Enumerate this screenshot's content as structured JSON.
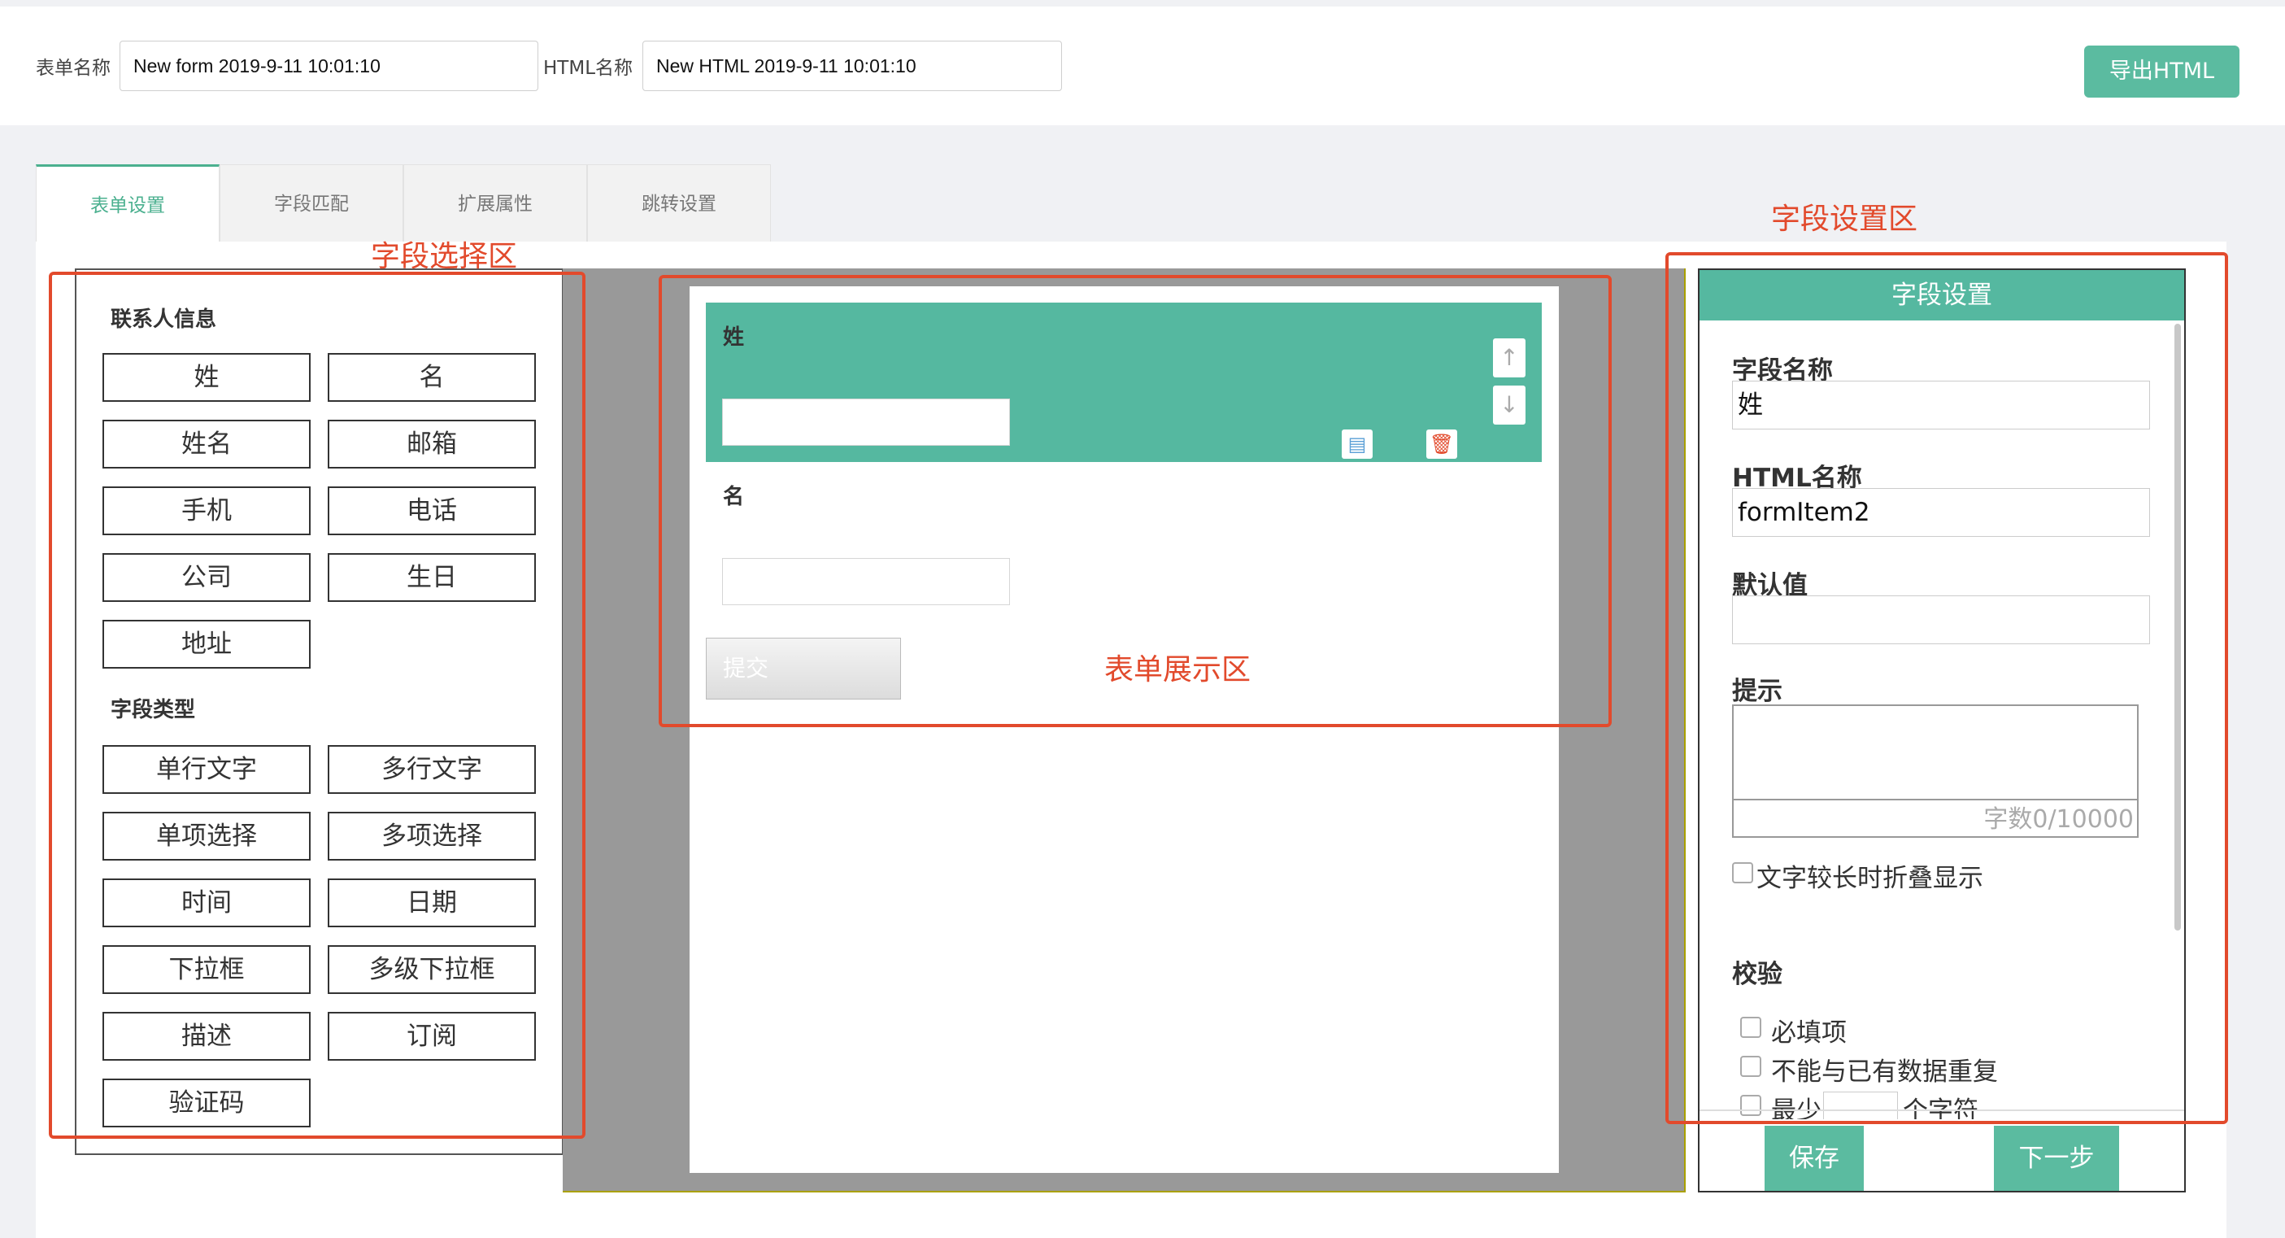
{
  "header": {
    "form_name_label": "表单名称",
    "form_name_value": "New form 2019-9-11 10:01:10",
    "html_name_label": "HTML名称",
    "html_name_value": "New HTML 2019-9-11 10:01:10",
    "export_button": "导出HTML"
  },
  "tabs": [
    {
      "label": "表单设置",
      "active": true
    },
    {
      "label": "字段匹配",
      "active": false
    },
    {
      "label": "扩展属性",
      "active": false
    },
    {
      "label": "跳转设置",
      "active": false
    }
  ],
  "field_selector": {
    "contact_title": "联系人信息",
    "contact_fields": [
      "姓",
      "名",
      "姓名",
      "邮箱",
      "手机",
      "电话",
      "公司",
      "生日",
      "地址"
    ],
    "type_title": "字段类型",
    "type_fields": [
      "单行文字",
      "多行文字",
      "单项选择",
      "多项选择",
      "时间",
      "日期",
      "下拉框",
      "多级下拉框",
      "描述",
      "订阅",
      "验证码"
    ]
  },
  "form_preview": {
    "field1_label": "姓",
    "field2_label": "名",
    "submit_label": "提交",
    "up_arrow": "↑",
    "down_arrow": "↓"
  },
  "settings": {
    "header": "字段设置",
    "field_name_label": "字段名称",
    "field_name_value": "姓",
    "html_name_label": "HTML名称",
    "html_name_value": "formItem2",
    "default_label": "默认值",
    "hint_label": "提示",
    "word_count": "字数0/10000",
    "collapse_label": "文字较长时折叠显示",
    "validation_label": "校验",
    "required_label": "必填项",
    "no_duplicate_label": "不能与已有数据重复",
    "min_label_partial": "最少",
    "chars_partial": "个字符",
    "save_button": "保存",
    "next_button": "下一步"
  },
  "annotations": {
    "field_select_area": "字段选择区",
    "form_display_area": "表单展示区",
    "field_settings_area": "字段设置区"
  },
  "colors": {
    "accent": "#55b8a0",
    "annotation_red": "#e24a2c"
  }
}
